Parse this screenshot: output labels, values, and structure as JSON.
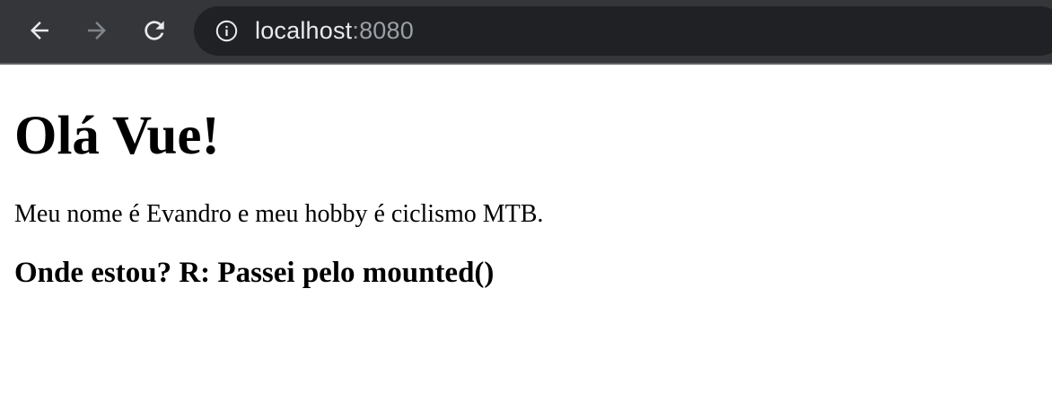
{
  "browser": {
    "url_host": "localhost",
    "url_port": ":8080",
    "icons": {
      "back": "back-arrow-icon",
      "forward": "forward-arrow-icon",
      "reload": "reload-icon",
      "info": "info-icon"
    },
    "colors": {
      "toolbar": "#35363a",
      "omnibox": "#202124",
      "icon_active": "#e8eaed",
      "icon_disabled": "#80868b"
    }
  },
  "page": {
    "heading": "Olá Vue!",
    "intro": "Meu nome é Evandro e meu hobby é ciclismo MTB.",
    "status": "Onde estou? R: Passei pelo mounted()"
  }
}
